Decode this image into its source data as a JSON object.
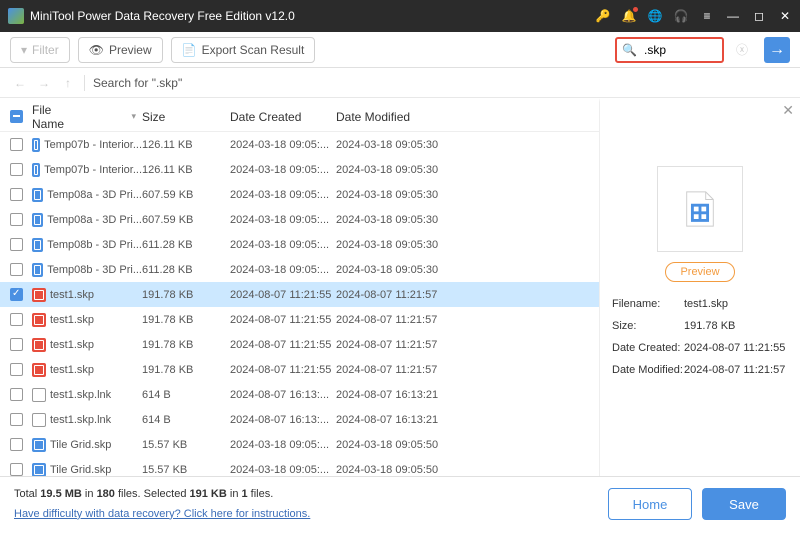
{
  "titlebar": {
    "title": "MiniTool Power Data Recovery Free Edition v12.0"
  },
  "toolbar": {
    "filter": "Filter",
    "preview": "Preview",
    "export": "Export Scan Result"
  },
  "search": {
    "value": ".skp"
  },
  "navbar": {
    "path": "Search for \".skp\""
  },
  "columns": {
    "fileName": "File Name",
    "size": "Size",
    "dateCreated": "Date Created",
    "dateModified": "Date Modified"
  },
  "rows": [
    {
      "icon": "skp",
      "name": "Temp07b - Interior...",
      "size": "126.11 KB",
      "dc": "2024-03-18 09:05:...",
      "dm": "2024-03-18 09:05:30",
      "sel": false
    },
    {
      "icon": "skp",
      "name": "Temp07b - Interior...",
      "size": "126.11 KB",
      "dc": "2024-03-18 09:05:...",
      "dm": "2024-03-18 09:05:30",
      "sel": false
    },
    {
      "icon": "skp",
      "name": "Temp08a - 3D Pri...",
      "size": "607.59 KB",
      "dc": "2024-03-18 09:05:...",
      "dm": "2024-03-18 09:05:30",
      "sel": false
    },
    {
      "icon": "skp",
      "name": "Temp08a - 3D Pri...",
      "size": "607.59 KB",
      "dc": "2024-03-18 09:05:...",
      "dm": "2024-03-18 09:05:30",
      "sel": false
    },
    {
      "icon": "skp",
      "name": "Temp08b - 3D Pri...",
      "size": "611.28 KB",
      "dc": "2024-03-18 09:05:...",
      "dm": "2024-03-18 09:05:30",
      "sel": false
    },
    {
      "icon": "skp",
      "name": "Temp08b - 3D Pri...",
      "size": "611.28 KB",
      "dc": "2024-03-18 09:05:...",
      "dm": "2024-03-18 09:05:30",
      "sel": false
    },
    {
      "icon": "skp-red",
      "name": "test1.skp",
      "size": "191.78 KB",
      "dc": "2024-08-07 11:21:55",
      "dm": "2024-08-07 11:21:57",
      "sel": true
    },
    {
      "icon": "skp-red",
      "name": "test1.skp",
      "size": "191.78 KB",
      "dc": "2024-08-07 11:21:55",
      "dm": "2024-08-07 11:21:57",
      "sel": false
    },
    {
      "icon": "skp-red",
      "name": "test1.skp",
      "size": "191.78 KB",
      "dc": "2024-08-07 11:21:55",
      "dm": "2024-08-07 11:21:57",
      "sel": false
    },
    {
      "icon": "skp-red",
      "name": "test1.skp",
      "size": "191.78 KB",
      "dc": "2024-08-07 11:21:55",
      "dm": "2024-08-07 11:21:57",
      "sel": false
    },
    {
      "icon": "lnk",
      "name": "test1.skp.lnk",
      "size": "614 B",
      "dc": "2024-08-07 16:13:...",
      "dm": "2024-08-07 16:13:21",
      "sel": false
    },
    {
      "icon": "lnk",
      "name": "test1.skp.lnk",
      "size": "614 B",
      "dc": "2024-08-07 16:13:...",
      "dm": "2024-08-07 16:13:21",
      "sel": false
    },
    {
      "icon": "skp",
      "name": "Tile Grid.skp",
      "size": "15.57 KB",
      "dc": "2024-03-18 09:05:...",
      "dm": "2024-03-18 09:05:50",
      "sel": false
    },
    {
      "icon": "skp",
      "name": "Tile Grid.skp",
      "size": "15.57 KB",
      "dc": "2024-03-18 09:05:...",
      "dm": "2024-03-18 09:05:50",
      "sel": false
    }
  ],
  "side": {
    "previewBtn": "Preview",
    "labels": {
      "filename": "Filename:",
      "size": "Size:",
      "dc": "Date Created:",
      "dm": "Date Modified:"
    },
    "filename": "test1.skp",
    "size": "191.78 KB",
    "dc": "2024-08-07 11:21:55",
    "dm": "2024-08-07 11:21:57"
  },
  "footer": {
    "status_prefix": "Total ",
    "total_size": "19.5 MB",
    "status_mid1": " in ",
    "total_files": "180",
    "status_mid2": " files.   Selected ",
    "sel_size": "191 KB",
    "status_mid3": " in ",
    "sel_files": "1",
    "status_suffix": " files.",
    "help": "Have difficulty with data recovery? Click here for instructions.",
    "home": "Home",
    "save": "Save"
  }
}
